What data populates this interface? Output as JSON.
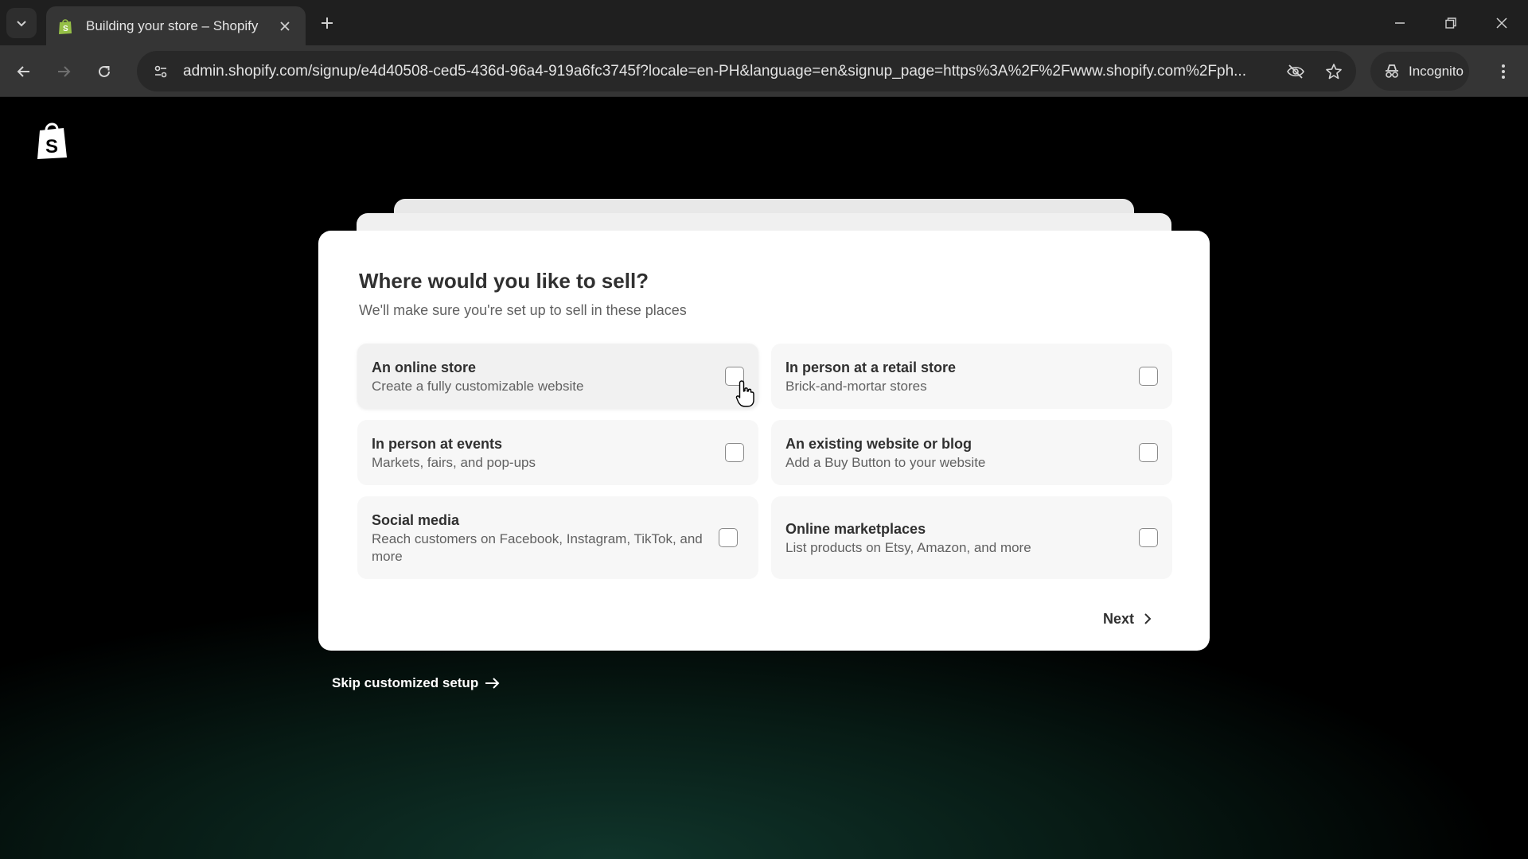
{
  "browser": {
    "tab_title": "Building your store – Shopify",
    "url": "admin.shopify.com/signup/e4d40508-ced5-436d-96a4-919a6fc3745f?locale=en-PH&language=en&signup_page=https%3A%2F%2Fwww.shopify.com%2Fph...",
    "incognito_label": "Incognito",
    "icons": [
      "tab-search-icon",
      "shopify-favicon-icon",
      "close-icon",
      "plus-icon",
      "minimize-icon",
      "restore-icon",
      "close-window-icon",
      "back-icon",
      "forward-icon",
      "reload-icon",
      "site-info-icon",
      "eye-off-icon",
      "star-icon",
      "incognito-icon",
      "more-vert-icon"
    ]
  },
  "card": {
    "heading": "Where would you like to sell?",
    "subheading": "We'll make sure you're set up to sell in these places",
    "options": [
      {
        "title": "An online store",
        "description": "Create a fully customizable website",
        "checked": false
      },
      {
        "title": "In person at a retail store",
        "description": "Brick-and-mortar stores",
        "checked": false
      },
      {
        "title": "In person at events",
        "description": "Markets, fairs, and pop-ups",
        "checked": false
      },
      {
        "title": "An existing website or blog",
        "description": "Add a Buy Button to your website",
        "checked": false
      },
      {
        "title": "Social media",
        "description": "Reach customers on Facebook, Instagram, TikTok, and more",
        "checked": false
      },
      {
        "title": "Online marketplaces",
        "description": "List products on Etsy, Amazon, and more",
        "checked": false
      }
    ],
    "next_label": "Next"
  },
  "skip_label": "Skip customized setup",
  "colors": {
    "chrome_dark": "#1f1f1f",
    "toolbar": "#353535",
    "card_bg": "#ffffff",
    "option_bg": "#f7f7f7",
    "text_primary": "#303030",
    "text_secondary": "#616161",
    "page_glow": "#10352b",
    "shopify_green": "#95bf47"
  }
}
